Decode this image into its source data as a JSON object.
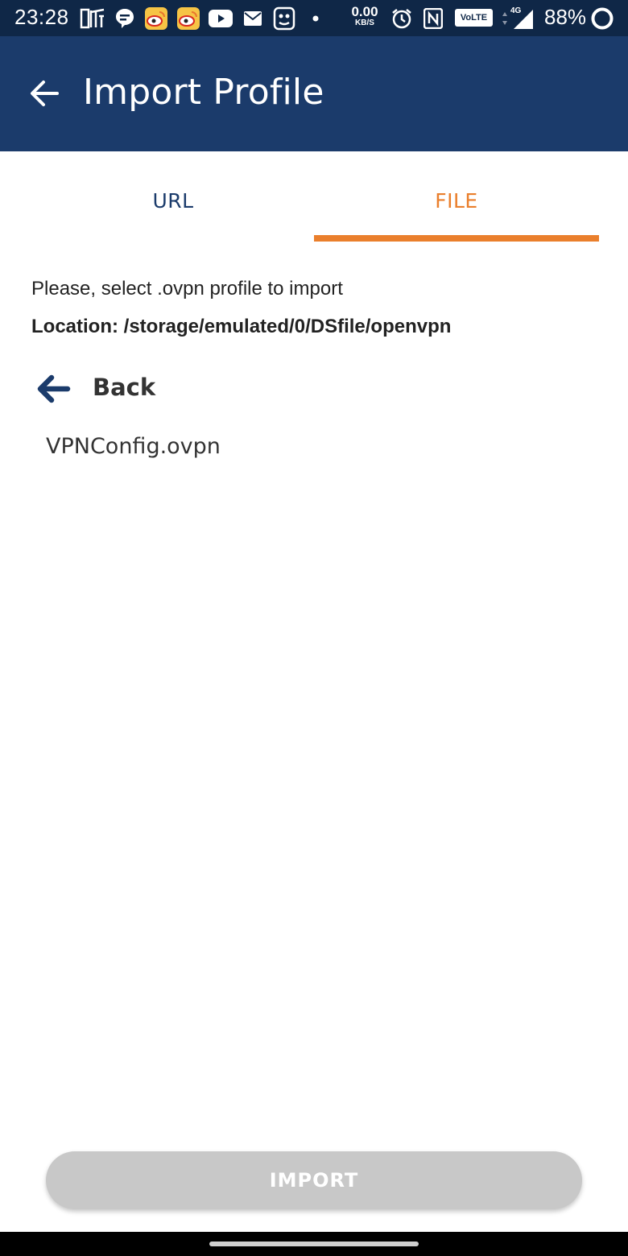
{
  "status_bar": {
    "time": "23:28",
    "net_speed_value": "0.00",
    "net_speed_unit": "KB/S",
    "volte": "VoLTE",
    "network_type": "4G",
    "battery": "88%",
    "icons": [
      "ting-icon",
      "chat-bubble-icon",
      "weibo-icon",
      "weibo-icon",
      "youtube-icon",
      "mail-icon",
      "app-icon",
      "dot-icon",
      "alarm-icon",
      "nfc-icon",
      "signal-icon",
      "battery-ring-icon"
    ]
  },
  "app_bar": {
    "title": "Import Profile",
    "background": "#1b3b6b",
    "back_icon": "arrow-left-icon"
  },
  "tabs": [
    {
      "label": "URL",
      "selected": false
    },
    {
      "label": "FILE",
      "selected": true
    }
  ],
  "accent_color": "#ea7f2c",
  "content": {
    "prompt": "Please, select .ovpn profile to import",
    "location": "Location: /storage/emulated/0/DSfile/openvpn",
    "back_label": "Back",
    "back_icon": "arrow-left-icon",
    "files": [
      {
        "name": "VPNConfig.ovpn"
      }
    ]
  },
  "import_button": {
    "label": "IMPORT",
    "enabled": false,
    "color": "#c8c8c8"
  }
}
